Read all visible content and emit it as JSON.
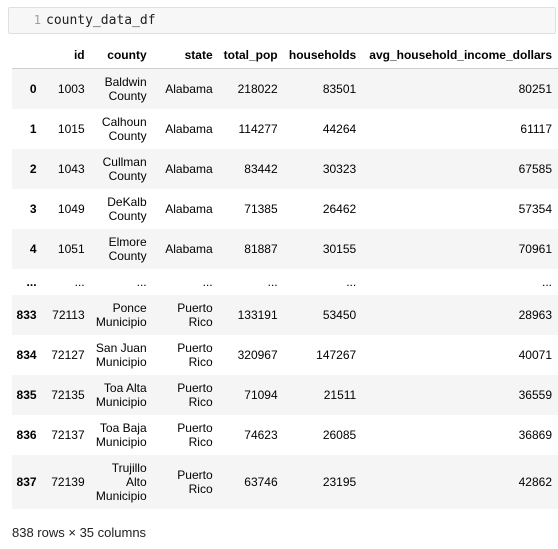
{
  "cell": {
    "line_number": "1",
    "code": "county_data_df"
  },
  "table": {
    "columns": [
      "",
      "id",
      "county",
      "state",
      "total_pop",
      "households",
      "avg_household_income_dollars"
    ],
    "rows": [
      {
        "index": "0",
        "id": "1003",
        "county": "Baldwin County",
        "state": "Alabama",
        "total_pop": "218022",
        "households": "83501",
        "income": "80251"
      },
      {
        "index": "1",
        "id": "1015",
        "county": "Calhoun County",
        "state": "Alabama",
        "total_pop": "114277",
        "households": "44264",
        "income": "61117"
      },
      {
        "index": "2",
        "id": "1043",
        "county": "Cullman County",
        "state": "Alabama",
        "total_pop": "83442",
        "households": "30323",
        "income": "67585"
      },
      {
        "index": "3",
        "id": "1049",
        "county": "DeKalb County",
        "state": "Alabama",
        "total_pop": "71385",
        "households": "26462",
        "income": "57354"
      },
      {
        "index": "4",
        "id": "1051",
        "county": "Elmore County",
        "state": "Alabama",
        "total_pop": "81887",
        "households": "30155",
        "income": "70961"
      },
      {
        "index": "...",
        "id": "...",
        "county": "...",
        "state": "...",
        "total_pop": "...",
        "households": "...",
        "income": "..."
      },
      {
        "index": "833",
        "id": "72113",
        "county": "Ponce Municipio",
        "state": "Puerto Rico",
        "total_pop": "133191",
        "households": "53450",
        "income": "28963"
      },
      {
        "index": "834",
        "id": "72127",
        "county": "San Juan Municipio",
        "state": "Puerto Rico",
        "total_pop": "320967",
        "households": "147267",
        "income": "40071"
      },
      {
        "index": "835",
        "id": "72135",
        "county": "Toa Alta Municipio",
        "state": "Puerto Rico",
        "total_pop": "71094",
        "households": "21511",
        "income": "36559"
      },
      {
        "index": "836",
        "id": "72137",
        "county": "Toa Baja Municipio",
        "state": "Puerto Rico",
        "total_pop": "74623",
        "households": "26085",
        "income": "36869"
      },
      {
        "index": "837",
        "id": "72139",
        "county": "Trujillo Alto Municipio",
        "state": "Puerto Rico",
        "total_pop": "63746",
        "households": "23195",
        "income": "42862"
      }
    ]
  },
  "shape_text": "838 rows × 35 columns"
}
